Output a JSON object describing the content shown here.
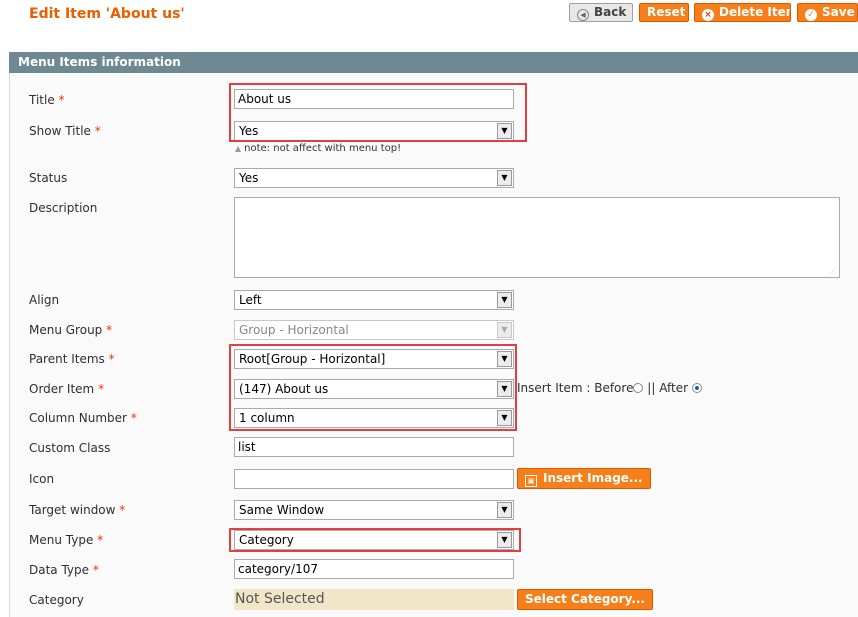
{
  "header": {
    "title": "Edit Item 'About us'",
    "buttons": {
      "back": "Back",
      "reset": "Reset",
      "delete": "Delete Item",
      "save": "Save I"
    }
  },
  "section": {
    "title": "Menu Items information"
  },
  "required_mark": "*",
  "form": {
    "title": {
      "label": "Title",
      "value": "About us"
    },
    "show_title": {
      "label": "Show Title",
      "value": "Yes",
      "note": "note: not affect with menu top!"
    },
    "status": {
      "label": "Status",
      "value": "Yes"
    },
    "description": {
      "label": "Description",
      "value": ""
    },
    "align": {
      "label": "Align",
      "value": "Left"
    },
    "menu_group": {
      "label": "Menu Group",
      "value": "Group - Horizontal"
    },
    "parent_items": {
      "label": "Parent Items",
      "value": "Root[Group - Horizontal]"
    },
    "order_item": {
      "label": "Order Item",
      "value": "(147) About us",
      "insert_label": "Insert Item : Before",
      "after_label": "|| After",
      "selected": "After"
    },
    "column_number": {
      "label": "Column Number",
      "value": "1 column"
    },
    "custom_class": {
      "label": "Custom Class",
      "value": "list"
    },
    "icon": {
      "label": "Icon",
      "value": "",
      "button": "Insert Image..."
    },
    "target_window": {
      "label": "Target window",
      "value": "Same Window"
    },
    "menu_type": {
      "label": "Menu Type",
      "value": "Category"
    },
    "data_type": {
      "label": "Data Type",
      "value": "category/107"
    },
    "category": {
      "label": "Category",
      "value": "Not Selected",
      "button": "Select Category..."
    }
  },
  "colors": {
    "accent": "#f77f1a",
    "title": "#eb5e00",
    "section_header": "#6f8992",
    "highlight": "#e04040",
    "required": "#eb340a"
  }
}
